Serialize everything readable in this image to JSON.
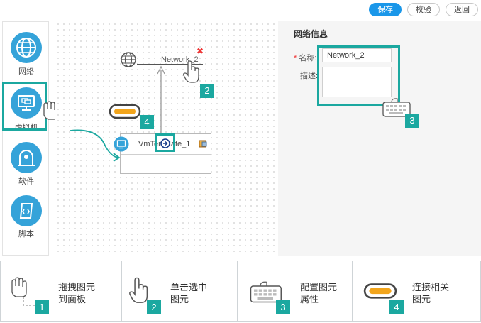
{
  "toolbar": {
    "save": "保存",
    "validate": "校验",
    "back": "返回"
  },
  "palette": {
    "items": [
      {
        "label": "网络",
        "icon": "globe-icon"
      },
      {
        "label": "虚拟机",
        "icon": "monitor-icon"
      },
      {
        "label": "软件",
        "icon": "software-icon"
      },
      {
        "label": "脚本",
        "icon": "script-icon"
      }
    ]
  },
  "canvas": {
    "network_label": "Network_2",
    "vm_label": "VmTemplate_1"
  },
  "properties": {
    "title": "网络信息",
    "name_label": "名称:",
    "required_mark": "*",
    "name_value": "Network_2",
    "desc_label": "描述:",
    "desc_value": ""
  },
  "badges": [
    "1",
    "2",
    "3",
    "4"
  ],
  "legend": [
    {
      "num": "1",
      "line1": "拖拽图元",
      "line2": "到面板",
      "icon": "drag-hand-icon"
    },
    {
      "num": "2",
      "line1": "单击选中",
      "line2": "图元",
      "icon": "click-hand-icon"
    },
    {
      "num": "3",
      "line1": "配置图元",
      "line2": "属性",
      "icon": "keyboard-icon"
    },
    {
      "num": "4",
      "line1": "连接相关",
      "line2": "图元",
      "icon": "link-icon"
    }
  ],
  "colors": {
    "accent": "#1a97e9",
    "teal": "#1ba8a0",
    "palette_icon": "#35a3d9"
  }
}
